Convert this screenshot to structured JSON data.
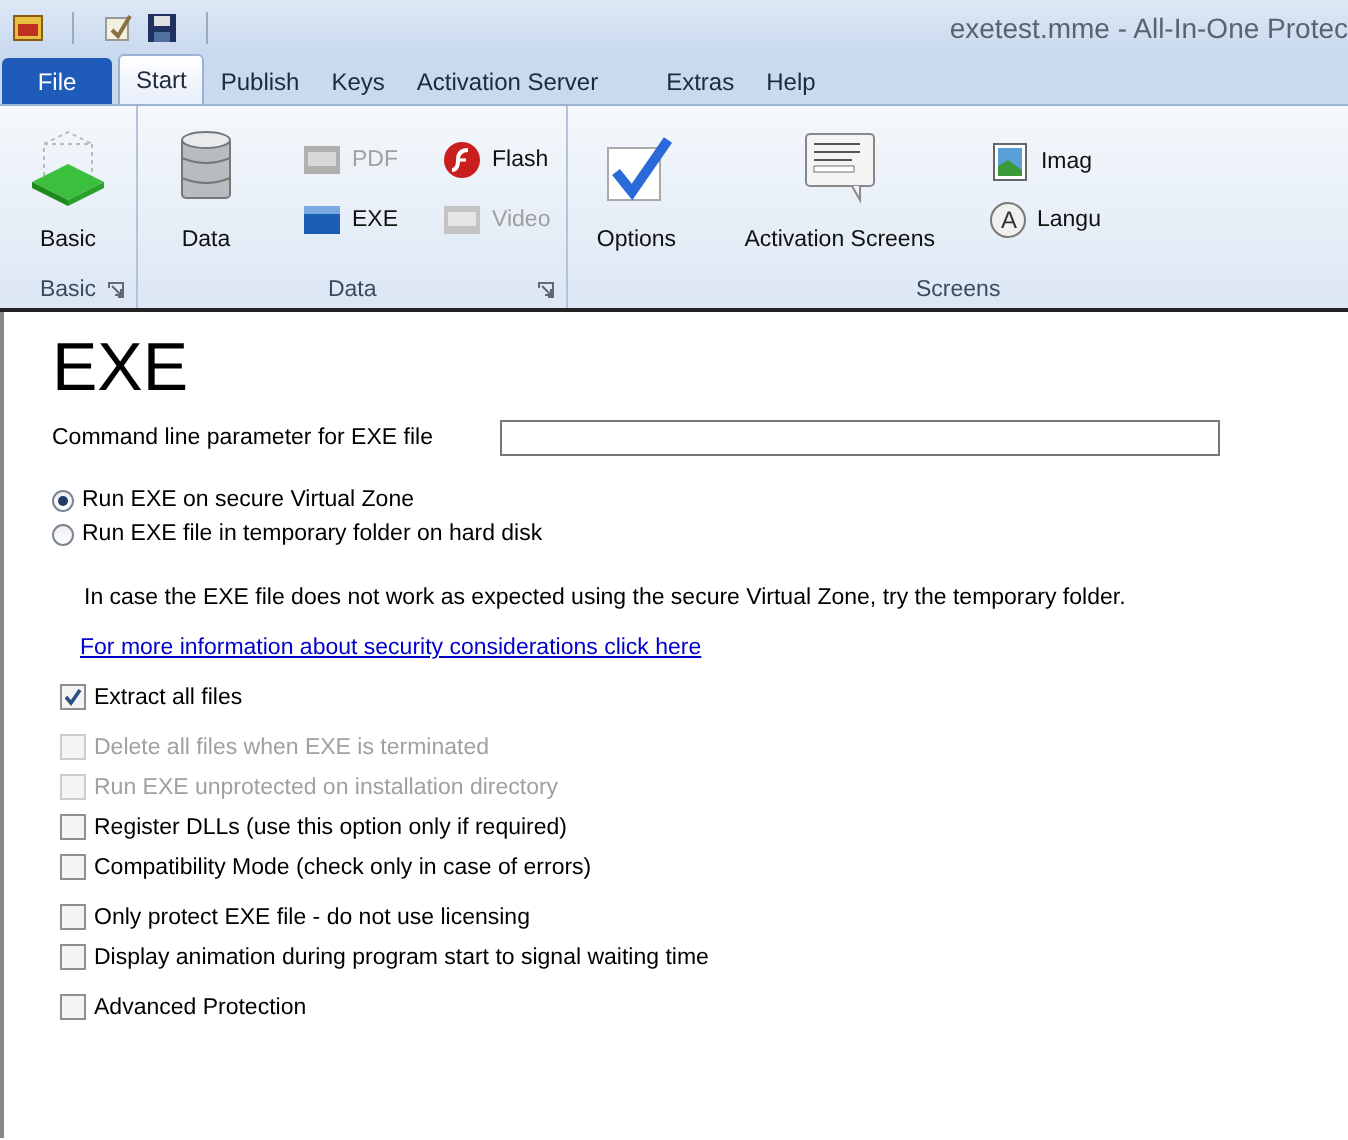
{
  "window": {
    "title": "exetest.mme  -  All-In-One Protec"
  },
  "menu_tabs": [
    {
      "label": "File",
      "kind": "file",
      "selected": false
    },
    {
      "label": "Start",
      "kind": "tab",
      "selected": true
    },
    {
      "label": "Publish",
      "kind": "tab",
      "selected": false
    },
    {
      "label": "Keys",
      "kind": "tab",
      "selected": false
    },
    {
      "label": "Activation Server",
      "kind": "tab",
      "selected": false
    },
    {
      "label": "Extras",
      "kind": "tab",
      "selected": false
    },
    {
      "label": "Help",
      "kind": "tab",
      "selected": false
    }
  ],
  "ribbon_groups": [
    {
      "label": "Basic",
      "launcher": true,
      "columns": [
        [
          {
            "label": "Basic",
            "kind": "large",
            "disabled": false
          }
        ]
      ]
    },
    {
      "label": "Data",
      "launcher": true,
      "columns": [
        [
          {
            "label": "Data",
            "kind": "large",
            "disabled": false
          }
        ],
        [
          {
            "label": "PDF",
            "kind": "small",
            "disabled": true
          },
          {
            "label": "EXE",
            "kind": "small",
            "disabled": false
          }
        ],
        [
          {
            "label": "Flash",
            "kind": "small",
            "disabled": false
          },
          {
            "label": "Video",
            "kind": "small",
            "disabled": true
          }
        ]
      ]
    },
    {
      "label": "Screens",
      "launcher": false,
      "columns": [
        [
          {
            "label": "Options",
            "kind": "large",
            "disabled": false
          }
        ],
        [
          {
            "label": "Activation Screens",
            "kind": "large",
            "disabled": false
          }
        ],
        [
          {
            "label": "Imag",
            "kind": "small",
            "disabled": false
          },
          {
            "label": "Langu",
            "icon_letter": "A",
            "kind": "small",
            "disabled": false
          }
        ]
      ]
    }
  ],
  "page": {
    "heading": "EXE",
    "command_line": {
      "label": "Command line parameter for EXE file"
    },
    "run_mode": [
      {
        "label": "Run EXE on secure Virtual Zone",
        "selected": true
      },
      {
        "label": "Run EXE file in temporary folder on hard disk",
        "selected": false
      }
    ],
    "note": "In case the EXE file does not work as expected using the secure Virtual Zone, try the temporary folder.",
    "link": "For more information about security considerations click here",
    "option_groups": [
      [
        {
          "label": "Extract all files",
          "checked": true,
          "disabled": false
        }
      ],
      [
        {
          "label": "Delete all files when EXE is terminated",
          "checked": false,
          "disabled": true
        },
        {
          "label": "Run EXE unprotected on installation directory",
          "checked": false,
          "disabled": true
        },
        {
          "label": "Register DLLs (use this option only if required)",
          "checked": false,
          "disabled": false
        },
        {
          "label": "Compatibility Mode (check only in case of errors)",
          "checked": false,
          "disabled": false
        }
      ],
      [
        {
          "label": "Only protect EXE file - do not use licensing",
          "checked": false,
          "disabled": false
        },
        {
          "label": "Display animation during program start to signal waiting time",
          "checked": false,
          "disabled": false
        }
      ],
      [
        {
          "label": "Advanced Protection",
          "checked": false,
          "disabled": false
        }
      ]
    ]
  }
}
